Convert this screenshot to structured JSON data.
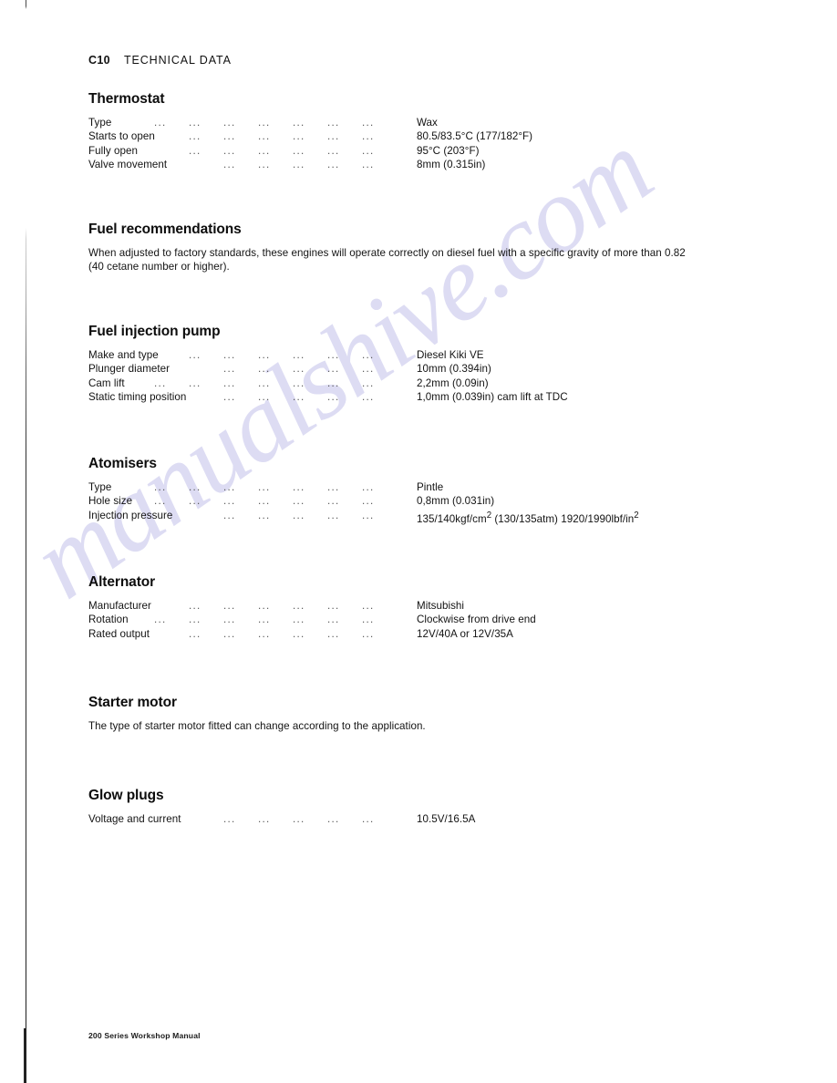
{
  "page": {
    "chapter_code": "C10",
    "chapter_title": "TECHNICAL DATA",
    "footer": "200 Series Workshop Manual",
    "watermark": "manualshive.com",
    "watermark_color": "#c9c8ec",
    "text_color": "#111111",
    "background_color": "#ffffff"
  },
  "sections": [
    {
      "id": "thermostat",
      "title": "Thermostat",
      "type": "spec-list",
      "rows": [
        {
          "label": "Type",
          "dots": 7,
          "value": "Wax"
        },
        {
          "label": "Starts to open",
          "dots": 6,
          "value": "80.5/83.5°C (177/182°F)"
        },
        {
          "label": "Fully open",
          "dots": 6,
          "value": "95°C (203°F)"
        },
        {
          "label": "Valve movement",
          "dots": 5,
          "value": "8mm (0.315in)"
        }
      ]
    },
    {
      "id": "fuel-recommendations",
      "title": "Fuel recommendations",
      "type": "paragraph",
      "body": "When adjusted to factory standards, these engines will operate correctly on diesel fuel with a specific gravity of more than 0.82 (40 cetane number or higher)."
    },
    {
      "id": "fuel-injection-pump",
      "title": "Fuel injection pump",
      "type": "spec-list",
      "rows": [
        {
          "label": "Make and type",
          "dots": 6,
          "value": "Diesel Kiki VE"
        },
        {
          "label": "Plunger diameter",
          "dots": 5,
          "value": "10mm (0.394in)"
        },
        {
          "label": "Cam lift",
          "dots": 7,
          "value": "2,2mm (0.09in)"
        },
        {
          "label": "Static timing position",
          "dots": 5,
          "value": "1,0mm (0.039in) cam lift at TDC"
        }
      ]
    },
    {
      "id": "atomisers",
      "title": "Atomisers",
      "type": "spec-list",
      "rows": [
        {
          "label": "Type",
          "dots": 7,
          "value": "Pintle"
        },
        {
          "label": "Hole size",
          "dots": 7,
          "value": "0,8mm (0.031in)"
        },
        {
          "label": "Injection pressure",
          "dots": 5,
          "value_parts": [
            {
              "t": "135/140kgf/cm"
            },
            {
              "t": "2",
              "sup": true
            },
            {
              "t": " (130/135atm) 1920/1990lbf/in"
            },
            {
              "t": "2",
              "sup": true
            }
          ]
        }
      ]
    },
    {
      "id": "alternator",
      "title": "Alternator",
      "type": "spec-list",
      "rows": [
        {
          "label": "Manufacturer",
          "dots": 6,
          "value": "Mitsubishi"
        },
        {
          "label": "Rotation",
          "dots": 7,
          "value": "Clockwise from drive end"
        },
        {
          "label": "Rated output",
          "dots": 6,
          "value": "12V/40A or 12V/35A"
        }
      ]
    },
    {
      "id": "starter-motor",
      "title": "Starter motor",
      "type": "paragraph",
      "body": "The type of starter motor fitted can change according to the application."
    },
    {
      "id": "glow-plugs",
      "title": "Glow plugs",
      "type": "spec-list",
      "rows": [
        {
          "label": "Voltage and current",
          "dots": 5,
          "value": "10.5V/16.5A"
        }
      ]
    }
  ],
  "layout": {
    "section_tops": [
      100,
      243,
      355,
      500,
      630,
      762,
      864
    ],
    "value_left": 360,
    "dot_stops": [
      72,
      110,
      148,
      186,
      224,
      262,
      300
    ],
    "ellipsis": "..."
  }
}
